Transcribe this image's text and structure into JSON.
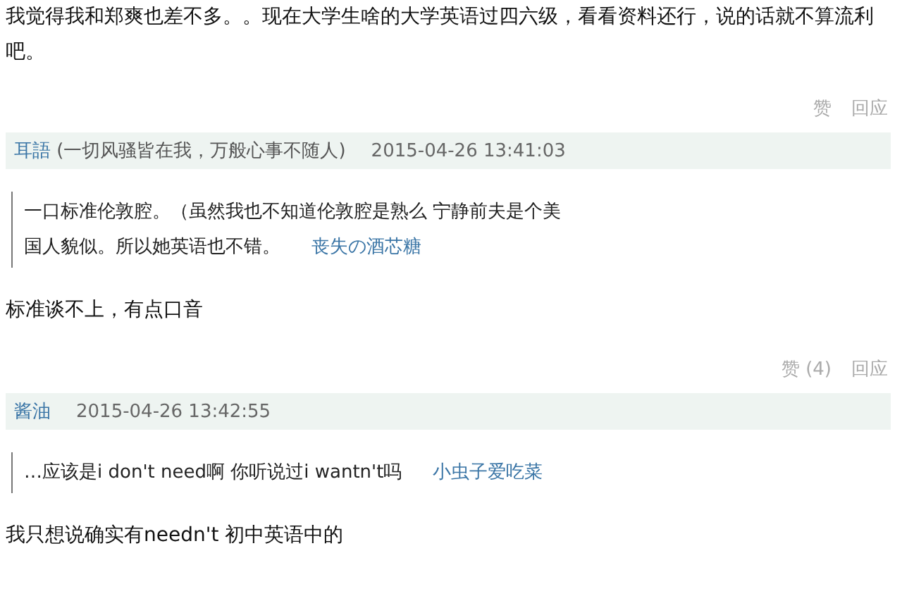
{
  "first_comment": {
    "text": "我觉得我和郑爽也差不多。。现在大学生啥的大学英语过四六级，看看资料还行，说的话就不算流利吧。",
    "actions": [
      "赞",
      "回应"
    ]
  },
  "comments": [
    {
      "author": "耳語",
      "signature": "(一切风骚皆在我，万般心事不随人)",
      "time": "2015-04-26 13:41:03",
      "quote": {
        "lines": [
          "一口标准伦敦腔。（虽然我也不知道伦敦腔是熟么 宁静前夫是个美",
          "国人貌似。所以她英语也不错。"
        ],
        "author": "丧失の酒芯糖"
      },
      "text": "标准谈不上，有点口音",
      "actions": [
        "赞 (4)",
        "回应"
      ]
    },
    {
      "author": "酱油",
      "time": "2015-04-26 13:42:55",
      "quote": {
        "lines": [
          "…应该是i don't need啊 你听说过i wantn't吗"
        ],
        "author": "小虫子爱吃菜"
      },
      "text": "我只想说确实有needn't 初中英语中的"
    }
  ]
}
